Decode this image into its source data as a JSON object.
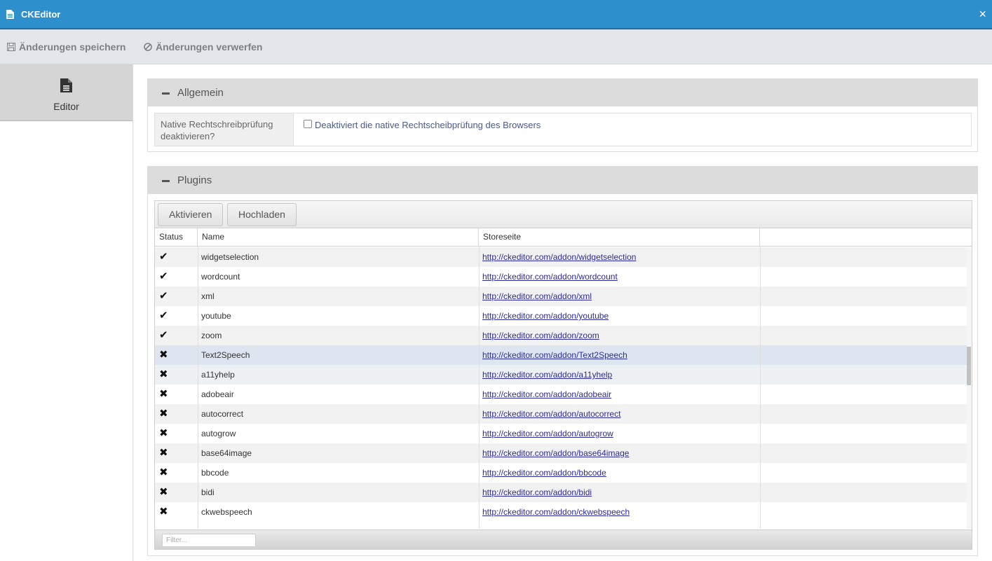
{
  "window": {
    "title": "CKEditor",
    "close_glyph": "×"
  },
  "toolbar": {
    "save_label": "Änderungen speichern",
    "discard_label": "Änderungen verwerfen"
  },
  "sidebar": {
    "items": [
      {
        "label": "Editor",
        "icon": "file-text-icon",
        "active": true
      }
    ]
  },
  "general": {
    "title": "Allgemein",
    "spellcheck_label": "Native Rechtschreibprüfung deaktivieren?",
    "spellcheck_checkbox_label": "Deaktiviert die native Rechtscheibprüfung des Browsers",
    "spellcheck_checked": false
  },
  "plugins": {
    "title": "Plugins",
    "activate_label": "Aktivieren",
    "upload_label": "Hochladen",
    "columns": [
      "Status",
      "Name",
      "Storeseite"
    ],
    "filter_placeholder": "Filter...",
    "rows": [
      {
        "status": "✔",
        "name": "widgetselection",
        "url": "http://ckeditor.com/addon/widgetselection"
      },
      {
        "status": "✔",
        "name": "wordcount",
        "url": "http://ckeditor.com/addon/wordcount"
      },
      {
        "status": "✔",
        "name": "xml",
        "url": "http://ckeditor.com/addon/xml"
      },
      {
        "status": "✔",
        "name": "youtube",
        "url": "http://ckeditor.com/addon/youtube"
      },
      {
        "status": "✔",
        "name": "zoom",
        "url": "http://ckeditor.com/addon/zoom"
      },
      {
        "status": "✖",
        "name": "Text2Speech",
        "url": "http://ckeditor.com/addon/Text2Speech"
      },
      {
        "status": "✖",
        "name": "a11yhelp",
        "url": "http://ckeditor.com/addon/a11yhelp"
      },
      {
        "status": "✖",
        "name": "adobeair",
        "url": "http://ckeditor.com/addon/adobeair"
      },
      {
        "status": "✖",
        "name": "autocorrect",
        "url": "http://ckeditor.com/addon/autocorrect"
      },
      {
        "status": "✖",
        "name": "autogrow",
        "url": "http://ckeditor.com/addon/autogrow"
      },
      {
        "status": "✖",
        "name": "base64image",
        "url": "http://ckeditor.com/addon/base64image"
      },
      {
        "status": "✖",
        "name": "bbcode",
        "url": "http://ckeditor.com/addon/bbcode"
      },
      {
        "status": "✖",
        "name": "bidi",
        "url": "http://ckeditor.com/addon/bidi"
      },
      {
        "status": "✖",
        "name": "ckwebspeech",
        "url": "http://ckeditor.com/addon/ckwebspeech"
      }
    ]
  },
  "colors": {
    "titlebar": "#2e8fcd",
    "link": "#2b2b9e",
    "selected_row": "#dde6f0"
  }
}
